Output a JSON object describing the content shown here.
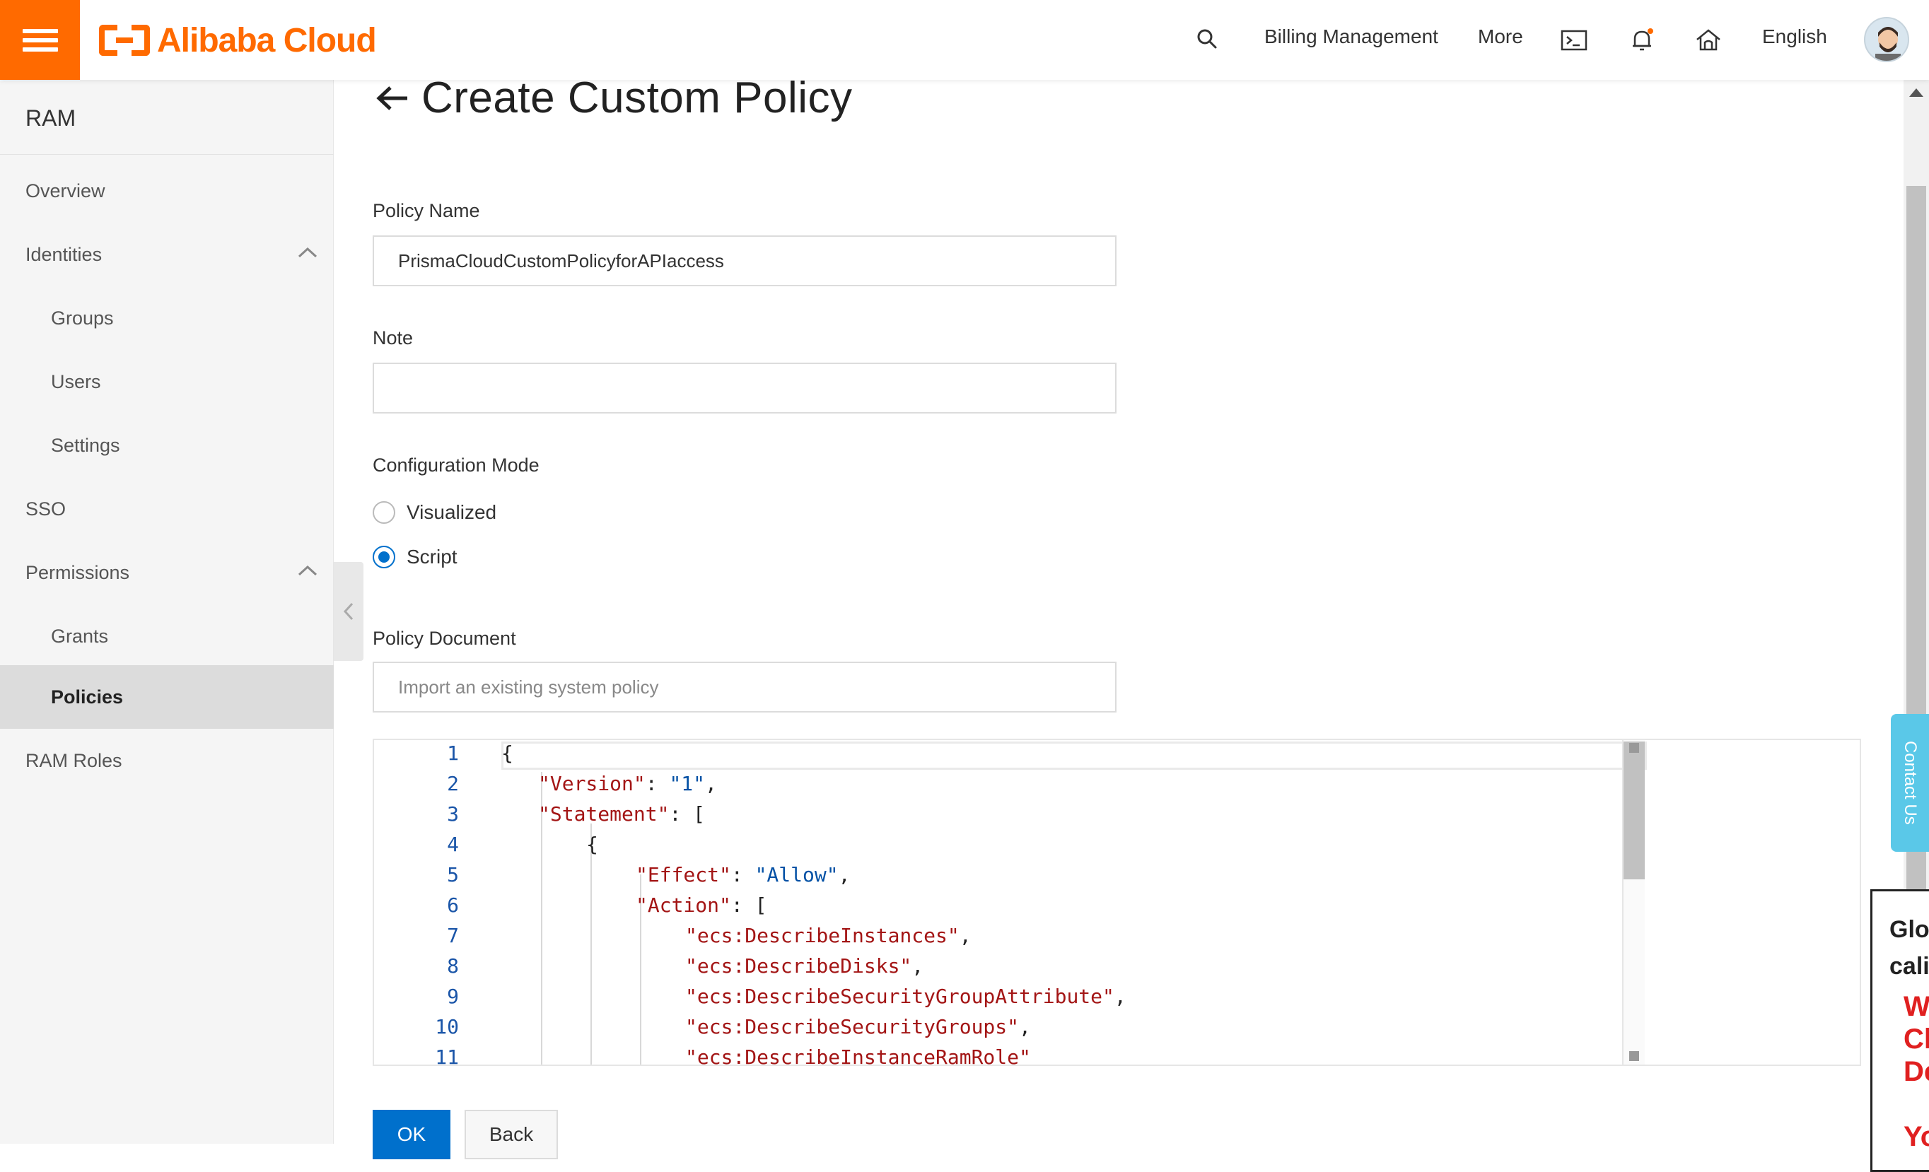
{
  "topbar": {
    "brand": "Alibaba Cloud",
    "links": [
      "Billing Management",
      "More",
      "English"
    ],
    "icons": [
      "search-icon",
      "terminal-icon",
      "bell-icon",
      "home-icon",
      "avatar"
    ]
  },
  "sidebar": {
    "title": "RAM",
    "items": [
      {
        "label": "Overview"
      },
      {
        "label": "Identities"
      },
      {
        "label": "Groups"
      },
      {
        "label": "Users"
      },
      {
        "label": "Settings"
      },
      {
        "label": "SSO"
      },
      {
        "label": "Permissions"
      },
      {
        "label": "Grants"
      },
      {
        "label": "Policies"
      },
      {
        "label": "RAM Roles"
      }
    ]
  },
  "page": {
    "title": "Create Custom Policy",
    "policy_name_label": "Policy Name",
    "policy_name_value": "PrismaCloudCustomPolicyforAPIaccess",
    "note_label": "Note",
    "note_value": "",
    "config_mode_label": "Configuration Mode",
    "mode_visualized": "Visualized",
    "mode_script": "Script",
    "selected_mode": "Script",
    "policy_doc_label": "Policy Document",
    "import_placeholder": "Import an existing system policy"
  },
  "editor": {
    "line_numbers": [
      "1",
      "2",
      "3",
      "4",
      "5",
      "6",
      "7",
      "8",
      "9",
      "10",
      "11"
    ],
    "lines": [
      "{",
      "\"Version\": \"1\",",
      "\"Statement\": [",
      "{",
      "\"Effect\": \"Allow\",",
      "\"Action\": [",
      "\"ecs:DescribeInstances\",",
      "\"ecs:DescribeDisks\",",
      "\"ecs:DescribeSecurityGroupAttribute\",",
      "\"ecs:DescribeSecurityGroups\",",
      "\"ecs:DescribeInstanceRamRole\""
    ]
  },
  "buttons": {
    "ok": "OK",
    "back": "Back"
  },
  "contact": "Contact Us",
  "popup": {
    "line1": "Glo",
    "line2": "cali",
    "line3": "W",
    "line4": "Cl",
    "line5": "De",
    "line6": "Yo"
  },
  "colors": {
    "brand": "#ff6a00",
    "primary": "#0070cc",
    "contact": "#5ac8e8"
  }
}
